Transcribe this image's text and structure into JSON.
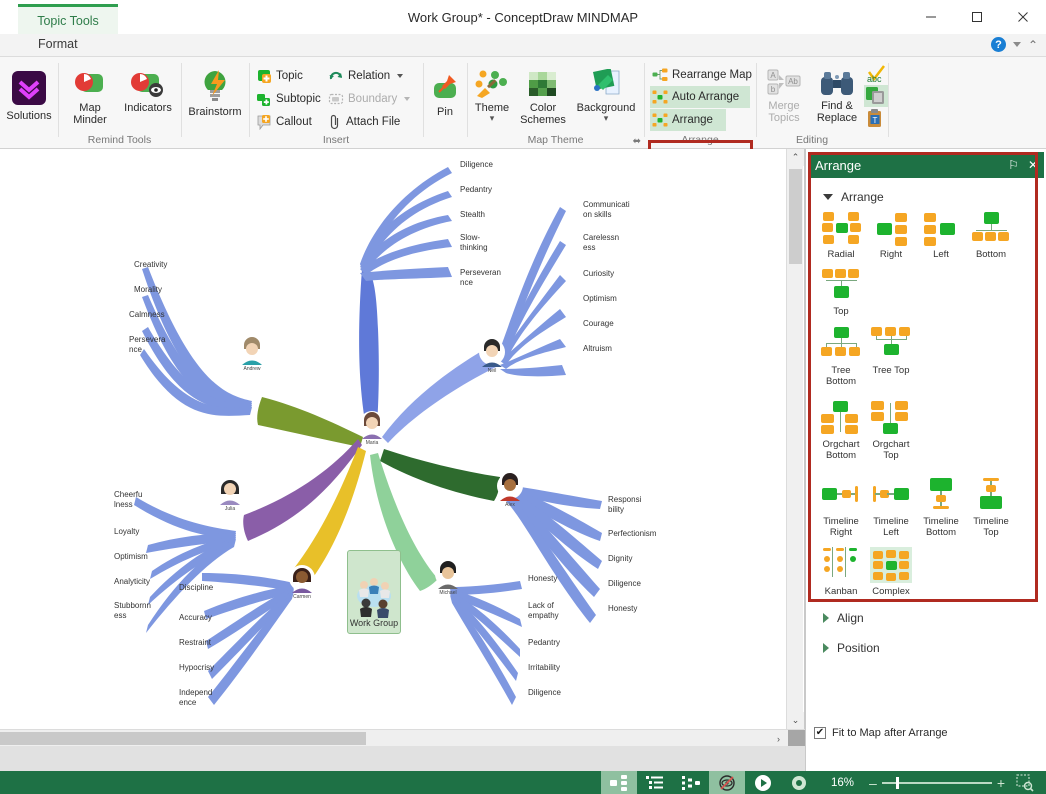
{
  "window": {
    "title": "Work Group* - ConceptDraw MINDMAP",
    "contextual_tab": "Topic Tools",
    "minimize": "—",
    "maximize": "☐",
    "close": "✕"
  },
  "menubar": {
    "format_tab": "Format",
    "help_label": "?",
    "customize_caret": "▾",
    "collapse_ribbon": "⌃"
  },
  "ribbon": {
    "groups": [
      {
        "name": "",
        "label": ""
      },
      {
        "name": "remind-tools",
        "label": "Remind Tools"
      },
      {
        "name": "insert",
        "label": "Insert"
      },
      {
        "name": "map-theme",
        "label": "Map Theme"
      },
      {
        "name": "arrange",
        "label": "Arrange"
      },
      {
        "name": "editing",
        "label": "Editing"
      }
    ],
    "solutions": "Solutions",
    "map_minder": "Map\nMinder",
    "indicators": "Indicators",
    "brainstorm": "Brainstorm",
    "topic": "Topic",
    "subtopic": "Subtopic",
    "callout": "Callout",
    "relation": "Relation",
    "boundary": "Boundary",
    "attach_file": "Attach File",
    "pin": "Pin",
    "theme": "Theme",
    "color_schemes": "Color\nSchemes",
    "background": "Background",
    "rearrange_map": "Rearrange Map",
    "auto_arrange": "Auto Arrange",
    "arrange": "Arrange",
    "merge_topics": "Merge\nTopics",
    "find_replace": "Find &\nReplace",
    "dialog_launcher": "⬌"
  },
  "panel": {
    "title": "Arrange",
    "pin_glyph": "⚐",
    "close_glyph": "✕",
    "sections": [
      {
        "name": "arrange",
        "label": "Arrange",
        "expanded": true
      },
      {
        "name": "align",
        "label": "Align",
        "expanded": false
      },
      {
        "name": "position",
        "label": "Position",
        "expanded": false
      }
    ],
    "arrange_options": [
      {
        "label": "Radial",
        "type": "radial"
      },
      {
        "label": "Right",
        "type": "right"
      },
      {
        "label": "Left",
        "type": "left"
      },
      {
        "label": "Bottom",
        "type": "bottom"
      },
      {
        "label": "Top",
        "type": "top"
      },
      {
        "label": "Tree\nBottom",
        "type": "tree-bottom"
      },
      {
        "label": "Tree\nTop",
        "type": "tree-top"
      },
      {
        "label": "Orgchart\nBottom",
        "type": "orgchart-bottom"
      },
      {
        "label": "Orgchart\nTop",
        "type": "orgchart-top"
      },
      {
        "label": "Timeline\nRight",
        "type": "timeline-right"
      },
      {
        "label": "Timeline\nLeft",
        "type": "timeline-left"
      },
      {
        "label": "Timeline\nBottom",
        "type": "timeline-bottom"
      },
      {
        "label": "Timeline\nTop",
        "type": "timeline-top"
      },
      {
        "label": "Kanban",
        "type": "kanban"
      },
      {
        "label": "Complex",
        "type": "complex",
        "selected": true
      }
    ],
    "fit_to_map": "Fit to Map after Arrange",
    "fit_to_map_checked": true,
    "checkmark": "✔"
  },
  "statusbar": {
    "zoom_level": "16%",
    "zoom_minus": "–",
    "zoom_plus": "+",
    "buttons": [
      {
        "name": "mindmap-view",
        "active": true
      },
      {
        "name": "outline-view",
        "active": false
      },
      {
        "name": "tree-view",
        "active": false
      },
      {
        "name": "hide-branch",
        "active": true
      },
      {
        "name": "presentation-play",
        "active": false
      },
      {
        "name": "gear-settings",
        "active": false
      }
    ],
    "fit_icon": "fit-to-window-icon"
  },
  "mindmap": {
    "center": "Work\nGroup",
    "persons": [
      {
        "name": "Maria",
        "color": "#3f6fd1"
      },
      {
        "name": "Neil",
        "color": "#6b8ee0"
      },
      {
        "name": "Andrew",
        "color": "#7a9a2f"
      },
      {
        "name": "Alex",
        "color": "#2e6b2e"
      },
      {
        "name": "Julia",
        "color": "#8a5ea8"
      },
      {
        "name": "Carmen",
        "color": "#e8c029"
      },
      {
        "name": "Michael",
        "color": "#8fd19a"
      }
    ],
    "branches": {
      "Maria": [
        "Diligence",
        "Pedantry",
        "Stealth",
        "Slow-\nthinking",
        "Perseveran\nnce"
      ],
      "Neil": [
        "Communicati\non skills",
        "Carelessn\ness",
        "Curiosity",
        "Optimism",
        "Courage",
        "Altruism"
      ],
      "Andrew": [
        "Creativity",
        "Morality",
        "Calmness",
        "Persevera\nnce"
      ],
      "Alex": [
        "Responsi\nbility",
        "Perfectionism",
        "Dignity",
        "Diligence",
        "Honesty"
      ],
      "Julia": [
        "Cheerfu\nlness",
        "Loyalty",
        "Optimism",
        "Analyticity",
        "Stubbornn\ness"
      ],
      "Carmen": [
        "Discipline",
        "Accuracy",
        "Restraint",
        "Hypocrisy",
        "Independ\nence"
      ],
      "Michael": [
        "Honesty",
        "Lack of\nempathy",
        "Pedantry",
        "Irritability",
        "Diligence"
      ]
    }
  },
  "scroll": {
    "up_arrow": "⌃",
    "down_arrow": "⌄",
    "right_arrow": "›"
  },
  "colors": {
    "accent_green": "#1e7145",
    "highlight_red": "#b02a20",
    "branch_blue": "#7e97e0",
    "node_green": "#1db32e",
    "node_orange": "#f5a623"
  }
}
